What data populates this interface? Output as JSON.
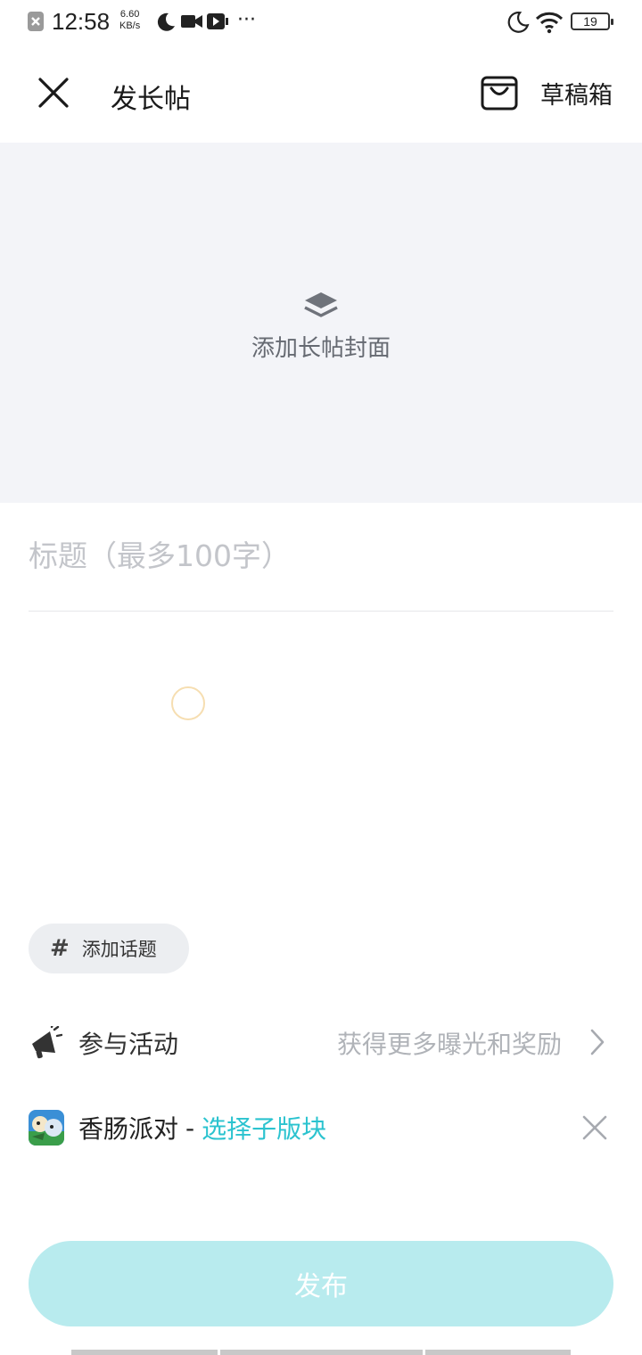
{
  "status_bar": {
    "time": "12:58",
    "net_speed_value": "6.60",
    "net_speed_unit": "KB/s",
    "more": "···",
    "battery": "19"
  },
  "header": {
    "title": "发长帖",
    "drafts_label": "草稿箱"
  },
  "cover": {
    "label": "添加长帖封面"
  },
  "post": {
    "title_placeholder": "标题（最多100字）"
  },
  "topic": {
    "hash": "#",
    "label": "添加话题"
  },
  "activity": {
    "label": "参与活动",
    "hint": "获得更多曝光和奖励"
  },
  "forum": {
    "name": "香肠派对",
    "separator": "-",
    "select_label": "选择子版块"
  },
  "publish": {
    "label": "发布"
  },
  "colors": {
    "accent": "#2bc3cf",
    "publish_bg": "#b8ebee",
    "cover_bg": "#f3f4f8"
  }
}
